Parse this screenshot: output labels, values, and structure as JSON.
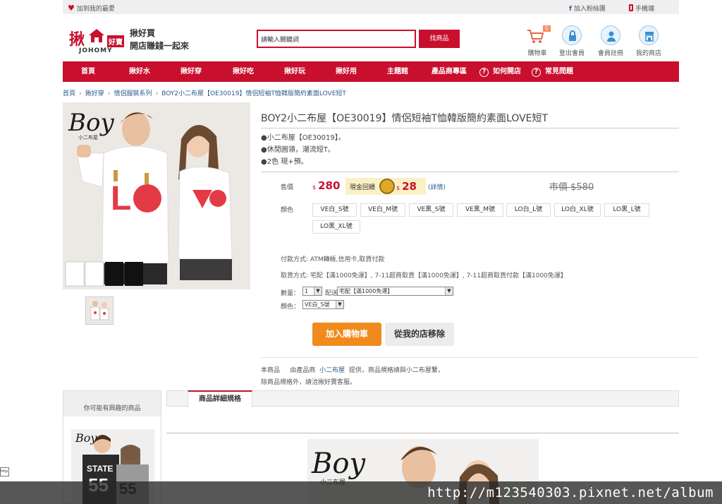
{
  "topbar": {
    "favorite": "加到我的最愛",
    "fans": "加入粉絲團",
    "mobile": "手機端"
  },
  "logo": {
    "jo": "揪",
    "haomai": "好賣",
    "brand": "JOHOMY",
    "slogan1": "揪好買",
    "slogan2": "開店賺錢一起來"
  },
  "search": {
    "value": "請輸入關鍵詞",
    "button": "找商品"
  },
  "header_icons": {
    "cart": "購物車",
    "cart_count": "0",
    "logout": "登出會員",
    "register": "會員註冊",
    "my_shop": "我的商店"
  },
  "nav": [
    "首頁",
    "揪好水",
    "揪好穿",
    "揪好吃",
    "揪好玩",
    "揪好用",
    "主題館",
    "產品商專區",
    "如何開店",
    "常見問題"
  ],
  "breadcrumb": [
    "首頁",
    "揪好穿",
    "情侶服裝系列",
    "BOY2小二布屋【OE30019】情侶短袖T恤韓版簡約素面LOVE短T"
  ],
  "product": {
    "image_logo": "Boy",
    "image_sub": "小二布屋",
    "title": "BOY2小二布屋【OE30019】情侶短袖T恤韓版簡約素面LOVE短T",
    "bullets": [
      "●小二布屋【OE30019】。",
      "●休閒圓領，潮流短T。",
      "●2色 現+預。"
    ],
    "price_label": "售價",
    "currency": "$",
    "price": "280",
    "cashback_label": "現金回饋",
    "cashback": "28",
    "detail_link": "(詳情)",
    "market_price": "市價 $580",
    "color_label": "顏色",
    "colors": [
      "VE白_S號",
      "VE白_M號",
      "VE黑_S號",
      "VE黑_M號",
      "LO白_L號",
      "LO白_XL號",
      "LO黑_L號",
      "LO黑_XL號"
    ],
    "payment": "付款方式: ATM轉帳,信用卡,取貨付款",
    "shipping": "取貨方式: 宅配【滿1000免運】, 7-11超商取貨【滿1000免運】, 7-11超商取貨付款【滿1000免運】",
    "qty_label": "數量：",
    "qty": "1",
    "delivery_label": "配送：",
    "delivery": "宅配【滿1000免運】",
    "color_select_label": "顏色：",
    "color_selected": "VE白_S號",
    "add_to_cart": "加入購物車",
    "remove_from_shop": "從我的店移除",
    "provider_line1_prefix": "本商品",
    "provider_line1_mid": "由產品商",
    "provider_shop": "小二布屋",
    "provider_line1_suffix": "提供，商品規格請與小二布屋繫，",
    "provider_line2": "除商品規格外，請洽揪好賣客服。"
  },
  "sidebar": {
    "title": "你可能有興趣的商品"
  },
  "tabs": {
    "spec": "商品詳細規格"
  },
  "watermark": "http://m123540303.pixnet.net/album",
  "corner_tag": "http"
}
